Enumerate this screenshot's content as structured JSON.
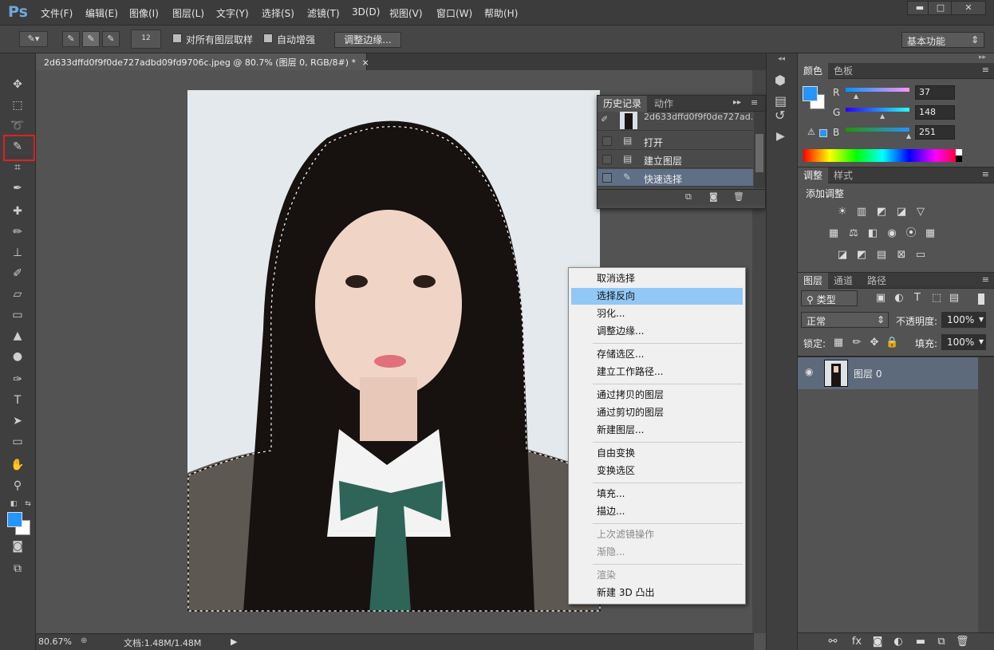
{
  "app": {
    "logo": "Ps"
  },
  "menubar": {
    "items": [
      "文件(F)",
      "编辑(E)",
      "图像(I)",
      "图层(L)",
      "文字(Y)",
      "选择(S)",
      "滤镜(T)",
      "3D(D)",
      "视图(V)",
      "窗口(W)",
      "帮助(H)"
    ]
  },
  "window_controls": {
    "minimize": "▬",
    "maximize": "□",
    "close": "✕"
  },
  "options_bar": {
    "brush_size": "12",
    "sample_all_layers": "对所有图层取样",
    "auto_enhance": "自动增强",
    "refine_edge": "调整边缘...",
    "workspace": "基本功能"
  },
  "document": {
    "tab_title": "2d633dffd0f9f0de727adbd09fd9706c.jpeg @ 80.7% (图层 0, RGB/8#) *",
    "close": "×"
  },
  "status": {
    "zoom": "80.67%",
    "doc_size": "文档:1.48M/1.48M"
  },
  "history_panel": {
    "tabs": [
      "历史记录",
      "动作"
    ],
    "snapshot": "2d633dffd0f9f0de727ad...",
    "items": [
      "打开",
      "建立图层",
      "快速选择"
    ],
    "selected_index": 2
  },
  "context_menu": {
    "items": [
      {
        "label": "取消选择"
      },
      {
        "label": "选择反向",
        "highlighted": true
      },
      {
        "label": "羽化..."
      },
      {
        "label": "调整边缘..."
      },
      {
        "sep": true
      },
      {
        "label": "存储选区..."
      },
      {
        "label": "建立工作路径..."
      },
      {
        "sep": true
      },
      {
        "label": "通过拷贝的图层"
      },
      {
        "label": "通过剪切的图层"
      },
      {
        "label": "新建图层..."
      },
      {
        "sep": true
      },
      {
        "label": "自由变换"
      },
      {
        "label": "变换选区"
      },
      {
        "sep": true
      },
      {
        "label": "填充..."
      },
      {
        "label": "描边..."
      },
      {
        "sep": true
      },
      {
        "label": "上次滤镜操作",
        "disabled": true
      },
      {
        "label": "渐隐...",
        "disabled": true
      },
      {
        "sep": true
      },
      {
        "label": "渲染",
        "disabled": true
      },
      {
        "label": "新建 3D 凸出"
      }
    ]
  },
  "color_panel": {
    "tabs": [
      "颜色",
      "色板"
    ],
    "r_label": "R",
    "g_label": "G",
    "b_label": "B",
    "r": "37",
    "g": "148",
    "b": "251",
    "fg_color": "#2594fb"
  },
  "adjust_panel": {
    "tabs": [
      "调整",
      "样式"
    ],
    "title": "添加调整"
  },
  "layers_panel": {
    "tabs": [
      "图层",
      "通道",
      "路径"
    ],
    "filter": "类型",
    "blend_mode": "正常",
    "opacity_label": "不透明度:",
    "opacity": "100%",
    "lock_label": "锁定:",
    "fill_label": "填充:",
    "fill": "100%",
    "layer_name": "图层 0"
  },
  "colors": {
    "accent": "#2594fb",
    "highlight_box": "#e02020",
    "menu_hl": "#91c8f6"
  }
}
